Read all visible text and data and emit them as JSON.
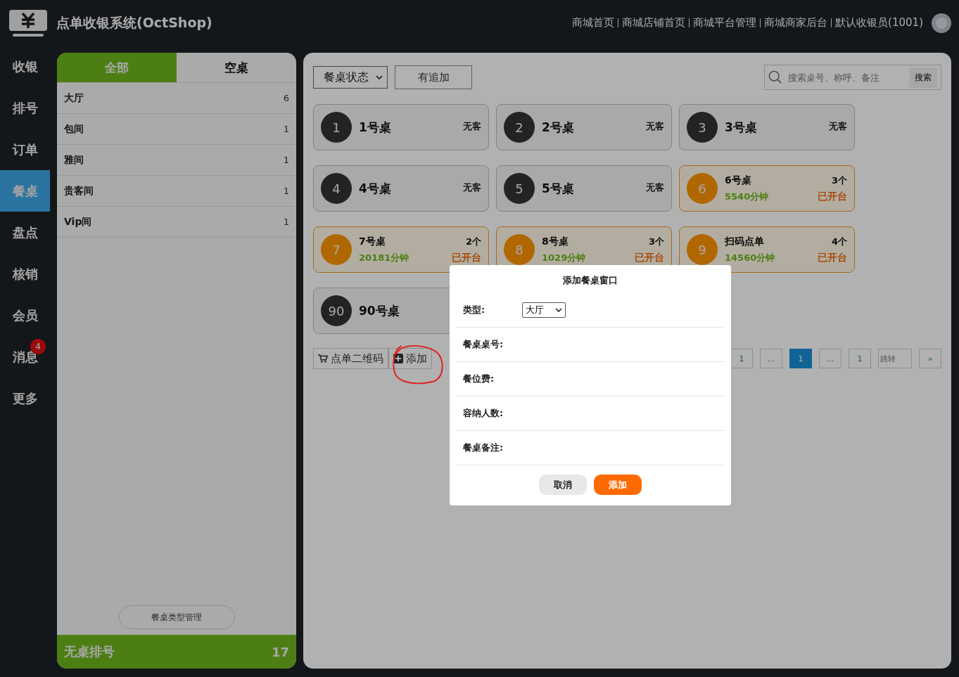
{
  "header": {
    "title": "点单收银系统(OctShop)",
    "links": [
      "商城首页",
      "商城店铺首页",
      "商城平台管理",
      "商城商家后台",
      "默认收银员(1001)"
    ]
  },
  "nav": [
    {
      "label": "收银",
      "selected": false
    },
    {
      "label": "排号",
      "selected": false
    },
    {
      "label": "订单",
      "selected": false
    },
    {
      "label": "餐桌",
      "selected": true
    },
    {
      "label": "盘点",
      "selected": false
    },
    {
      "label": "核销",
      "selected": false
    },
    {
      "label": "会员",
      "selected": false
    },
    {
      "label": "消息",
      "selected": false,
      "badge": "4"
    },
    {
      "label": "更多",
      "selected": false
    }
  ],
  "side_tabs": [
    {
      "label": "全部",
      "selected": true
    },
    {
      "label": "空桌",
      "selected": false
    }
  ],
  "categories": [
    {
      "name": "大厅",
      "count": "6"
    },
    {
      "name": "包间",
      "count": "1"
    },
    {
      "name": "雅间",
      "count": "1"
    },
    {
      "name": "贵客间",
      "count": "1"
    },
    {
      "name": "Vip间",
      "count": "1"
    }
  ],
  "manage_button": "餐桌类型管理",
  "queue": {
    "label": "无桌排号",
    "count": "17"
  },
  "toolbar": {
    "status_select": "餐桌状态",
    "append_button": "有追加",
    "search_placeholder": "搜索桌号、称呼、备注",
    "search_button": "搜索"
  },
  "tables": [
    {
      "number": "1",
      "name": "1号桌",
      "kind": "empty",
      "status": "无客"
    },
    {
      "number": "2",
      "name": "2号桌",
      "kind": "empty",
      "status": "无客"
    },
    {
      "number": "3",
      "name": "3号桌",
      "kind": "empty",
      "status": "无客"
    },
    {
      "number": "4",
      "name": "4号桌",
      "kind": "empty",
      "status": "无客"
    },
    {
      "number": "5",
      "name": "5号桌",
      "kind": "empty",
      "status": "无客"
    },
    {
      "number": "6",
      "name": "6号桌",
      "kind": "open",
      "count": "3个",
      "minutes": "5540分钟",
      "status": "已开台"
    },
    {
      "number": "7",
      "name": "7号桌",
      "kind": "open",
      "count": "2个",
      "minutes": "20181分钟",
      "status": "已开台"
    },
    {
      "number": "8",
      "name": "8号桌",
      "kind": "open",
      "count": "3个",
      "minutes": "1029分钟",
      "status": "已开台"
    },
    {
      "number": "9",
      "name": "扫码点单",
      "kind": "open",
      "count": "4个",
      "minutes": "14560分钟",
      "status": "已开台"
    },
    {
      "number": "90",
      "name": "90号桌",
      "kind": "empty"
    }
  ],
  "actions": {
    "qr_button": "点单二维码",
    "add_button": "添加"
  },
  "pagination": {
    "pages": [
      {
        "label": "1",
        "selected": false
      },
      {
        "label": "...",
        "selected": false
      },
      {
        "label": "1",
        "selected": true
      },
      {
        "label": "...",
        "selected": false
      },
      {
        "label": "1",
        "selected": false
      }
    ],
    "jump_placeholder": "跳转",
    "next": "»"
  },
  "modal": {
    "title": "添加餐桌窗口",
    "fields": [
      {
        "label": "类型:",
        "kind": "select",
        "value": "大厅"
      },
      {
        "label": "餐桌桌号:",
        "kind": "text"
      },
      {
        "label": "餐位费:",
        "kind": "text"
      },
      {
        "label": "容纳人数:",
        "kind": "text"
      },
      {
        "label": "餐桌备注:",
        "kind": "text"
      }
    ],
    "cancel": "取消",
    "confirm": "添加"
  }
}
